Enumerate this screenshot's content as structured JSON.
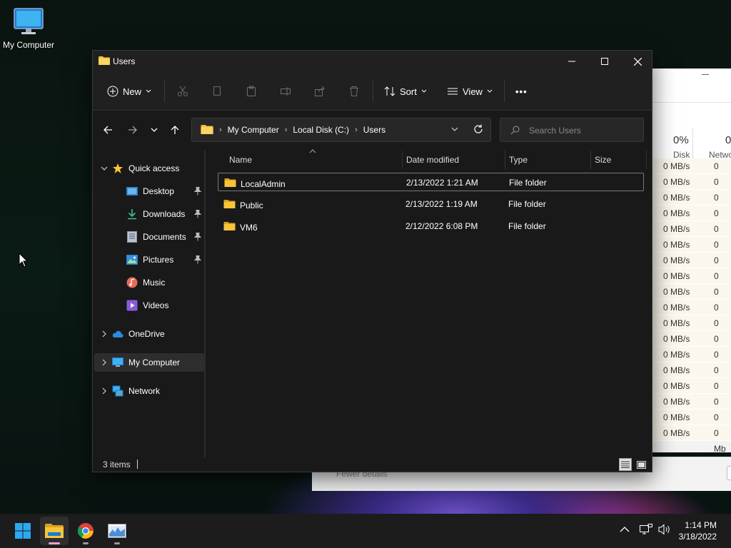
{
  "desktop": {
    "icons": [
      {
        "label": "My Computer",
        "icon": "monitor-icon"
      }
    ]
  },
  "background_window": {
    "disk_percent": "0%",
    "network_percent": "0",
    "disk_label": "Disk",
    "network_label": "Netwo",
    "rate_label": "0 MB/s",
    "rate_label_clipped": "0 Mb",
    "row_count": 18,
    "fewer_details": "Fewer details"
  },
  "explorer": {
    "title": "Users",
    "toolbar": {
      "new_label": "New",
      "sort_label": "Sort",
      "view_label": "View",
      "more_label": "•••"
    },
    "breadcrumb": [
      "My Computer",
      "Local Disk (C:)",
      "Users"
    ],
    "search_placeholder": "Search Users",
    "nav": {
      "quick_access": "Quick access",
      "quick_items": [
        {
          "label": "Desktop",
          "icon": "desktop-folder-icon",
          "pinned": true
        },
        {
          "label": "Downloads",
          "icon": "downloads-icon",
          "pinned": true
        },
        {
          "label": "Documents",
          "icon": "documents-icon",
          "pinned": true
        },
        {
          "label": "Pictures",
          "icon": "pictures-icon",
          "pinned": true
        },
        {
          "label": "Music",
          "icon": "music-icon",
          "pinned": false
        },
        {
          "label": "Videos",
          "icon": "videos-icon",
          "pinned": false
        }
      ],
      "onedrive": "OneDrive",
      "my_computer": "My Computer",
      "network": "Network"
    },
    "columns": {
      "name": "Name",
      "date": "Date modified",
      "type": "Type",
      "size": "Size"
    },
    "files": [
      {
        "name": "LocalAdmin",
        "date": "2/13/2022 1:21 AM",
        "type": "File folder",
        "size": ""
      },
      {
        "name": "Public",
        "date": "2/13/2022 1:19 AM",
        "type": "File folder",
        "size": ""
      },
      {
        "name": "VM6",
        "date": "2/12/2022 6:08 PM",
        "type": "File folder",
        "size": ""
      }
    ],
    "status": "3 items"
  },
  "taskbar": {
    "apps": [
      "start-icon",
      "file-explorer-icon",
      "chrome-icon",
      "task-manager-icon"
    ],
    "time": "1:14 PM",
    "date": "3/18/2022"
  },
  "colors": {
    "accent": "#4cc2ff",
    "folder": "#f8c53a",
    "taskbar": "#1c1c1c",
    "explorer_bg": "#191919"
  }
}
